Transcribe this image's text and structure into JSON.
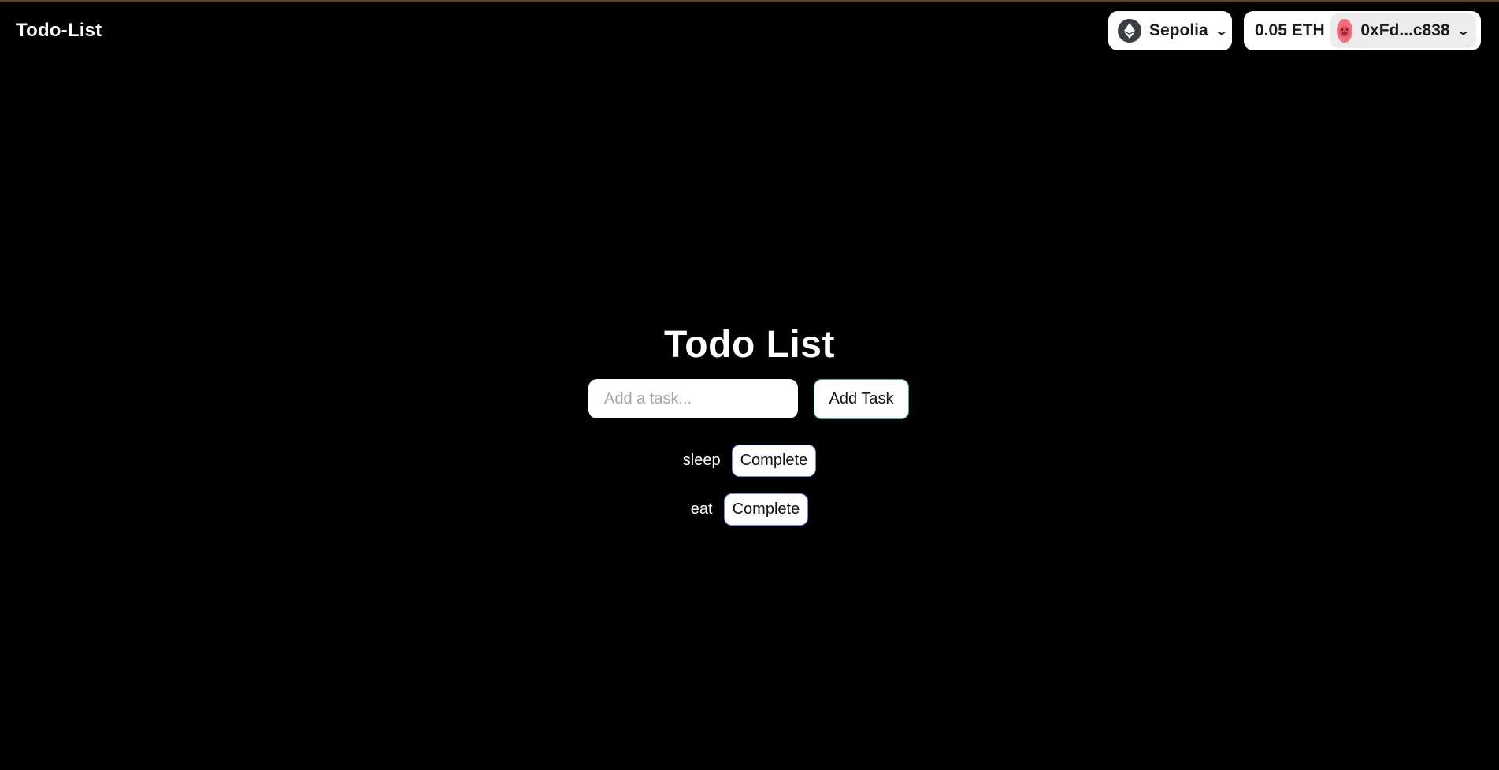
{
  "header": {
    "brand": "Todo-List",
    "network": {
      "label": "Sepolia",
      "icon": "ethereum-icon"
    },
    "account": {
      "balance": "0.05 ETH",
      "address": "0xFd...c838",
      "avatar_icon": "pig-avatar-icon",
      "avatar_color": "#f26d7d"
    }
  },
  "main": {
    "title": "Todo List",
    "input": {
      "placeholder": "Add a task...",
      "value": ""
    },
    "add_button": "Add Task",
    "tasks": [
      {
        "text": "sleep",
        "button": "Complete"
      },
      {
        "text": "eat",
        "button": "Complete"
      }
    ]
  },
  "colors": {
    "background": "#000000",
    "add_button_border": "#3fb97a",
    "complete_button_border": "#6a8ae0"
  }
}
